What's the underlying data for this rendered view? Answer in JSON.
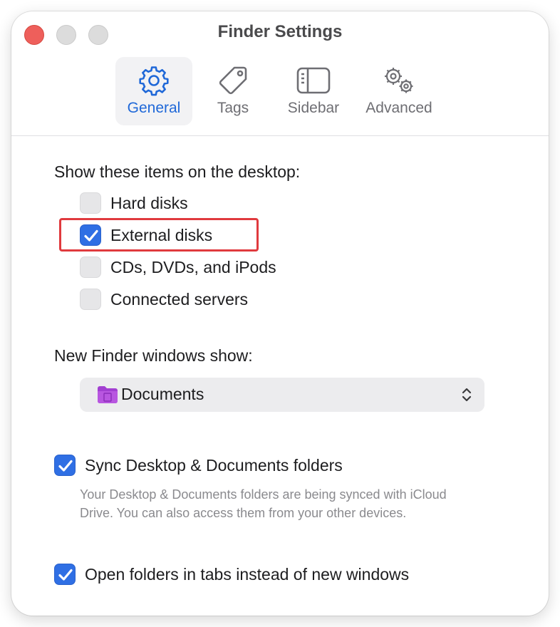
{
  "window": {
    "title": "Finder Settings"
  },
  "tabs": [
    {
      "label": "General",
      "icon": "gear-icon",
      "selected": true
    },
    {
      "label": "Tags",
      "icon": "tag-icon",
      "selected": false
    },
    {
      "label": "Sidebar",
      "icon": "sidebar-icon",
      "selected": false
    },
    {
      "label": "Advanced",
      "icon": "gears-icon",
      "selected": false
    }
  ],
  "desktop_items": {
    "heading": "Show these items on the desktop:",
    "items": [
      {
        "label": "Hard disks",
        "checked": false
      },
      {
        "label": "External disks",
        "checked": true,
        "highlighted": true
      },
      {
        "label": "CDs, DVDs, and iPods",
        "checked": false
      },
      {
        "label": "Connected servers",
        "checked": false
      }
    ]
  },
  "new_windows": {
    "heading": "New Finder windows show:",
    "selected_value": "Documents",
    "icon": "folder-icon"
  },
  "sync": {
    "label": "Sync Desktop & Documents folders",
    "checked": true,
    "description": "Your Desktop & Documents folders are being synced with iCloud Drive. You can also access them from your other devices."
  },
  "tabs_option": {
    "label": "Open folders in tabs instead of new windows",
    "checked": true
  },
  "colors": {
    "accent": "#2f6fe4",
    "selected_tab_text": "#1f68d8",
    "highlight": "#e03a3e",
    "close": "#ee5f5b",
    "folder": "#a23fd1"
  }
}
